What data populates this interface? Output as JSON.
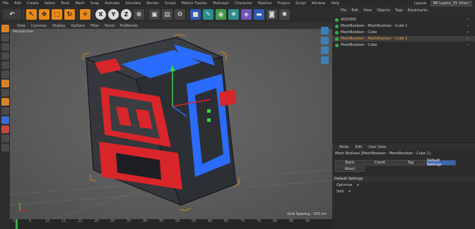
{
  "menubar": {
    "items": [
      "File",
      "Edit",
      "Create",
      "Select",
      "Tools",
      "Mesh",
      "Snap",
      "Animate",
      "Simulate",
      "Render",
      "Sculpt",
      "Motion Tracker",
      "MoGraph",
      "Character",
      "Pipeline",
      "Plugins",
      "Script",
      "Window",
      "Help"
    ],
    "layout_label": "Layout:",
    "layout_value": "RR Layout_01 (User)"
  },
  "toolbar": {
    "axis_x": "X",
    "axis_y": "Y",
    "axis_z": "Z"
  },
  "viewport": {
    "menu": [
      "View",
      "Cameras",
      "Display",
      "Options",
      "Filter",
      "Panel",
      "ProRender"
    ],
    "label": "Perspective",
    "grid_spacing": "Grid Spacing : 100 cm"
  },
  "timeline": {
    "ticks": [
      "0",
      "5",
      "10",
      "15",
      "20",
      "25",
      "30",
      "35",
      "40",
      "45",
      "50",
      "55",
      "60",
      "65",
      "70",
      "75",
      "80",
      "85",
      "90"
    ]
  },
  "object_manager": {
    "menu": [
      "File",
      "Edit",
      "View",
      "Objects",
      "Tags",
      "Bookmarks"
    ],
    "rows": [
      {
        "label": "ADDONS",
        "selected": false
      },
      {
        "label": "MeshBoolean - MeshBoolean - Cube 1",
        "selected": false
      },
      {
        "label": "MeshBoolean - Cube",
        "selected": false
      },
      {
        "label": "MeshBoolean - MeshBoolean - Cube 1",
        "selected": true
      },
      {
        "label": "MeshBoolean - Cube",
        "selected": false
      }
    ]
  },
  "attributes": {
    "menu": [
      "Mode",
      "Edit",
      "User Data"
    ],
    "title": "Mesh Boolean [MeshBoolean - MeshBoolean - Cube 1]",
    "tabs": [
      "Basic",
      "Coord.",
      "Tag",
      "Default Settings"
    ],
    "active_tab": "Default Settings",
    "tab_about": "About",
    "section": "Default Settings",
    "params": [
      {
        "label": "Optimize",
        "value": "✔"
      },
      {
        "label": "Solo",
        "value": "✔"
      }
    ]
  },
  "colors": {
    "accent_orange": "#e88a1a",
    "cube_red": "#d8262a",
    "cube_blue": "#2a6cff",
    "dark_gray": "#3a3d42",
    "selection_green": "#3aa84d"
  }
}
